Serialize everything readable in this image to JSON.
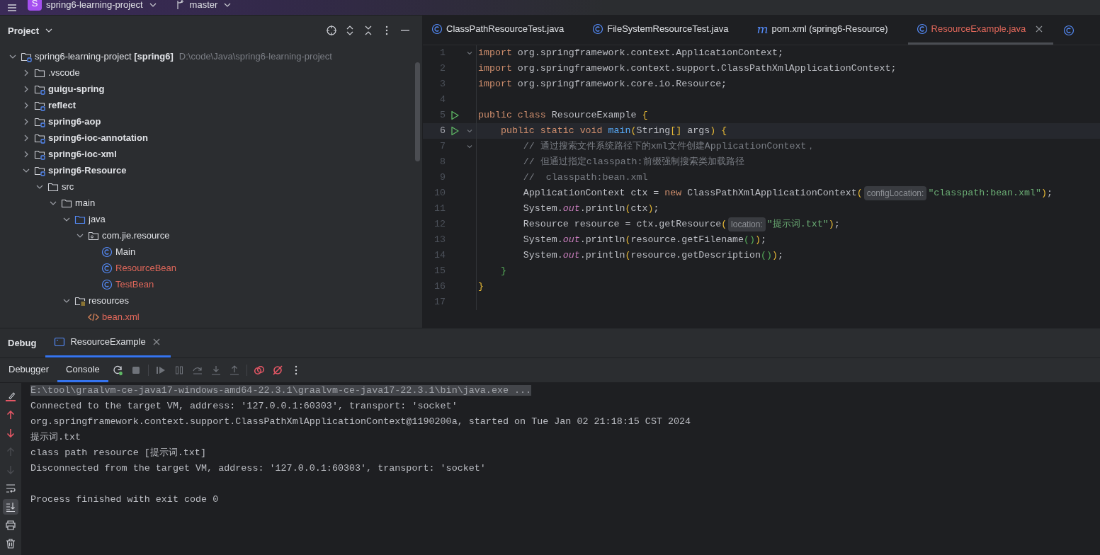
{
  "top_bar": {
    "project_badge": "S",
    "project": "spring6-learning-project",
    "branch": "master"
  },
  "project_panel": {
    "title": "Project",
    "tree": [
      {
        "label": "spring6-learning-project **[spring6]**",
        "path": "D:\\code\\Java\\spring6-learning-project",
        "kind": "project",
        "expanded": true,
        "children": [
          {
            "label": ".vscode",
            "kind": "folder",
            "expanded": false
          },
          {
            "label": "guigu-spring",
            "kind": "module",
            "expanded": false
          },
          {
            "label": "reflect",
            "kind": "module",
            "expanded": false
          },
          {
            "label": "spring6-aop",
            "kind": "module",
            "expanded": false
          },
          {
            "label": "spring6-ioc-annotation",
            "kind": "module",
            "expanded": false
          },
          {
            "label": "spring6-ioc-xml",
            "kind": "module",
            "expanded": false
          },
          {
            "label": "spring6-Resource",
            "kind": "module",
            "expanded": true,
            "children": [
              {
                "label": "src",
                "kind": "folder",
                "expanded": true,
                "children": [
                  {
                    "label": "main",
                    "kind": "folder",
                    "expanded": true,
                    "children": [
                      {
                        "label": "java",
                        "kind": "source",
                        "expanded": true,
                        "children": [
                          {
                            "label": "com.jie.resource",
                            "kind": "package",
                            "expanded": true,
                            "children": [
                              {
                                "label": "Main",
                                "kind": "class",
                                "unversioned": false
                              },
                              {
                                "label": "ResourceBean",
                                "kind": "class",
                                "unversioned": true
                              },
                              {
                                "label": "TestBean",
                                "kind": "class",
                                "unversioned": true
                              }
                            ]
                          }
                        ]
                      },
                      {
                        "label": "resources",
                        "kind": "resources",
                        "expanded": true,
                        "children": [
                          {
                            "label": "bean.xml",
                            "kind": "xml",
                            "unversioned": true
                          }
                        ]
                      }
                    ]
                  }
                ]
              }
            ]
          }
        ]
      }
    ]
  },
  "editor": {
    "tabs": [
      {
        "label": "ClassPathResourceTest.java",
        "kind": "class",
        "selected": false,
        "unversioned": false
      },
      {
        "label": "FileSystemResourceTest.java",
        "kind": "class",
        "selected": false,
        "unversioned": false
      },
      {
        "label": "pom.xml (spring6-Resource)",
        "kind": "maven",
        "icon_text": "m",
        "selected": false,
        "unversioned": false
      },
      {
        "label": "ResourceExample.java",
        "kind": "class",
        "selected": true,
        "unversioned": true
      }
    ],
    "lines": [
      {
        "number": "1",
        "run": false,
        "foldable": true,
        "current": false,
        "tokens": [
          {
            "kind": "kw",
            "text": "import "
          },
          {
            "kind": "plain",
            "text": "org.springframework.context.ApplicationContext;"
          }
        ]
      },
      {
        "number": "2",
        "run": false,
        "foldable": false,
        "current": false,
        "tokens": [
          {
            "kind": "kw",
            "text": "import "
          },
          {
            "kind": "plain",
            "text": "org.springframework.context.support.ClassPathXmlApplicationContext;"
          }
        ]
      },
      {
        "number": "3",
        "run": false,
        "foldable": false,
        "current": false,
        "tokens": [
          {
            "kind": "kw",
            "text": "import "
          },
          {
            "kind": "plain",
            "text": "org.springframework.core.io.Resource;"
          }
        ]
      },
      {
        "number": "4",
        "run": false,
        "foldable": false,
        "current": false
      },
      {
        "number": "5",
        "run": true,
        "foldable": false,
        "current": false,
        "tokens": [
          {
            "kind": "kw",
            "text": "public class "
          },
          {
            "kind": "plain",
            "text": "ResourceExample "
          },
          {
            "kind": "b1",
            "text": "{"
          }
        ]
      },
      {
        "number": "6",
        "run": true,
        "foldable": true,
        "current": true,
        "tokens": [
          {
            "kind": "kw",
            "text": "    public static void "
          },
          {
            "kind": "method",
            "text": "main"
          },
          {
            "kind": "b1",
            "text": "("
          },
          {
            "kind": "plain",
            "text": "String"
          },
          {
            "kind": "b1",
            "text": "[]"
          },
          {
            "kind": "plain",
            "text": " args"
          },
          {
            "kind": "b1",
            "text": ") {"
          }
        ]
      },
      {
        "number": "7",
        "run": false,
        "foldable": true,
        "current": false,
        "tokens": [
          {
            "kind": "comment",
            "text": "        // 通过搜索文件系统路径下的xml文件创建ApplicationContext，"
          }
        ]
      },
      {
        "number": "8",
        "run": false,
        "foldable": false,
        "current": false,
        "tokens": [
          {
            "kind": "comment",
            "text": "        // 但通过指定classpath:前缀强制搜索类加载路径"
          }
        ]
      },
      {
        "number": "9",
        "run": false,
        "foldable": false,
        "current": false,
        "tokens": [
          {
            "kind": "comment",
            "text": "        //  classpath:bean.xml"
          }
        ]
      },
      {
        "number": "10",
        "run": false,
        "foldable": false,
        "current": false,
        "tokens": [
          {
            "kind": "plain",
            "text": "        ApplicationContext ctx = "
          },
          {
            "kind": "kw",
            "text": "new"
          },
          {
            "kind": "plain",
            "text": " ClassPathXmlApplicationContext"
          },
          {
            "kind": "b1",
            "text": "("
          },
          {
            "kind": "hint",
            "text": "configLocation:"
          },
          {
            "kind": "str",
            "text": "\"classpath:bean.xml\""
          },
          {
            "kind": "b1",
            "text": ")"
          },
          {
            "kind": "plain",
            "text": ";"
          }
        ]
      },
      {
        "number": "11",
        "run": false,
        "foldable": false,
        "current": false,
        "tokens": [
          {
            "kind": "plain",
            "text": "        System."
          },
          {
            "kind": "field",
            "text": "out"
          },
          {
            "kind": "plain",
            "text": ".println"
          },
          {
            "kind": "b1",
            "text": "("
          },
          {
            "kind": "plain",
            "text": "ctx"
          },
          {
            "kind": "b1",
            "text": ")"
          },
          {
            "kind": "plain",
            "text": ";"
          }
        ]
      },
      {
        "number": "12",
        "run": false,
        "foldable": false,
        "current": false,
        "tokens": [
          {
            "kind": "plain",
            "text": "        Resource resource = ctx.getResource"
          },
          {
            "kind": "b1",
            "text": "("
          },
          {
            "kind": "hint",
            "text": "location:"
          },
          {
            "kind": "str",
            "text": "\"提示词.txt\""
          },
          {
            "kind": "b1",
            "text": ")"
          },
          {
            "kind": "plain",
            "text": ";"
          }
        ]
      },
      {
        "number": "13",
        "run": false,
        "foldable": false,
        "current": false,
        "tokens": [
          {
            "kind": "plain",
            "text": "        System."
          },
          {
            "kind": "field",
            "text": "out"
          },
          {
            "kind": "plain",
            "text": ".println"
          },
          {
            "kind": "b1",
            "text": "("
          },
          {
            "kind": "plain",
            "text": "resource.getFilename"
          },
          {
            "kind": "b2",
            "text": "()"
          },
          {
            "kind": "b1",
            "text": ")"
          },
          {
            "kind": "plain",
            "text": ";"
          }
        ]
      },
      {
        "number": "14",
        "run": false,
        "foldable": false,
        "current": false,
        "tokens": [
          {
            "kind": "plain",
            "text": "        System."
          },
          {
            "kind": "field",
            "text": "out"
          },
          {
            "kind": "plain",
            "text": ".println"
          },
          {
            "kind": "b1",
            "text": "("
          },
          {
            "kind": "plain",
            "text": "resource.getDescription"
          },
          {
            "kind": "b2",
            "text": "()"
          },
          {
            "kind": "b1",
            "text": ")"
          },
          {
            "kind": "plain",
            "text": ";"
          }
        ]
      },
      {
        "number": "15",
        "run": false,
        "foldable": false,
        "current": false,
        "tokens": [
          {
            "kind": "b2",
            "text": "    }"
          }
        ]
      },
      {
        "number": "16",
        "run": false,
        "foldable": false,
        "current": false,
        "tokens": [
          {
            "kind": "b1",
            "text": "}"
          }
        ]
      },
      {
        "number": "17",
        "run": false,
        "foldable": false,
        "current": false
      }
    ]
  },
  "debug_panel": {
    "title": "Debug",
    "session_tab": {
      "label": "ResourceExample",
      "selected": true
    },
    "tabs": [
      {
        "label": "Debugger",
        "selected": false
      },
      {
        "label": "Console",
        "selected": true
      }
    ],
    "console": [
      {
        "kind": "output",
        "text": "E:\\tool\\graalvm-ce-java17-windows-amd64-22.3.1\\graalvm-ce-java17-22.3.1\\bin\\java.exe ...",
        "selected": true
      },
      {
        "kind": "output",
        "text": "Connected to the target VM, address: '127.0.0.1:60303', transport: 'socket'",
        "selected": false
      },
      {
        "kind": "output",
        "text": "org.springframework.context.support.ClassPathXmlApplicationContext@1190200a, started on Tue Jan 02 21:18:15 CST 2024",
        "selected": false
      },
      {
        "kind": "output",
        "text": "提示词.txt",
        "selected": false
      },
      {
        "kind": "output",
        "text": "class path resource [提示词.txt]",
        "selected": false
      },
      {
        "kind": "output",
        "text": "Disconnected from the target VM, address: '127.0.0.1:60303', transport: 'socket'",
        "selected": false
      },
      {
        "kind": "blank"
      },
      {
        "kind": "output",
        "text": "Process finished with exit code 0",
        "selected": false
      }
    ]
  }
}
